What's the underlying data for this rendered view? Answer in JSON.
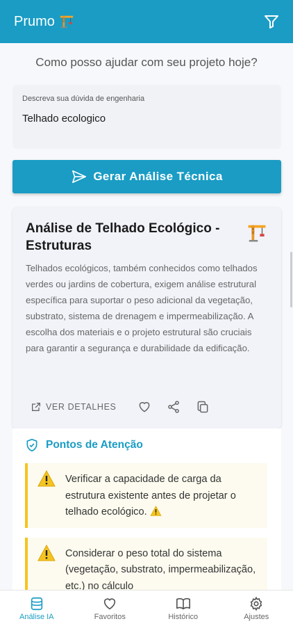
{
  "header": {
    "title": "Prumo",
    "title_icon": "crane-emoji",
    "filter_icon": "filter-icon"
  },
  "prompt": "Como posso ajudar com seu projeto hoje?",
  "input": {
    "label": "Descreva sua dúvida de engenharia",
    "value": "Telhado ecologico"
  },
  "generate_button": {
    "label": "Gerar Análise Técnica",
    "icon": "send-icon"
  },
  "result_card": {
    "title": "Análise de Telhado Ecológico - Estruturas",
    "icon": "crane-emoji",
    "text": "Telhados ecológicos, também conhecidos como telhados verdes ou jardins de cobertura, exigem análise estrutural específica para suportar o peso adicional da vegetação, substrato, sistema de drenagem e impermeabilização. A escolha dos materiais e o projeto estrutural são cruciais para garantir a segurança e durabilidade da edificação.",
    "details_label": "VER DETALHES",
    "actions": [
      "external-link-icon",
      "heart-icon",
      "share-icon",
      "copy-icon"
    ]
  },
  "attention": {
    "title": "Pontos de Atenção",
    "icon": "shield-check-icon",
    "items": [
      "Verificar a capacidade de carga da estrutura existente antes de projetar o telhado ecológico.",
      "Considerar o peso total do sistema (vegetação, substrato, impermeabilização, etc.) no cálculo"
    ]
  },
  "bottom_nav": [
    {
      "label": "Análise IA",
      "icon": "database-icon",
      "active": true
    },
    {
      "label": "Favoritos",
      "icon": "heart-icon",
      "active": false
    },
    {
      "label": "Histórico",
      "icon": "book-icon",
      "active": false
    },
    {
      "label": "Ajustes",
      "icon": "gear-icon",
      "active": false
    }
  ],
  "colors": {
    "primary": "#1a9cc4",
    "warning": "#f5c422",
    "warning_bg": "#fdfbef"
  }
}
